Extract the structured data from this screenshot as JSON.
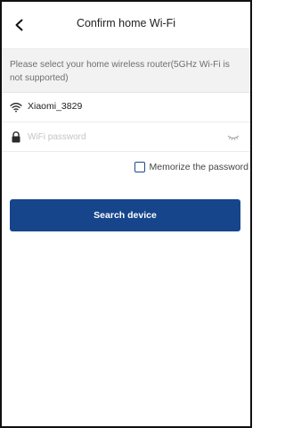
{
  "header": {
    "title": "Confirm home Wi-Fi",
    "back_icon": "chevron-left-icon"
  },
  "info": {
    "text": "Please select your home wireless router(5GHz Wi-Fi is not supported)"
  },
  "wifi": {
    "icon": "wifi-icon",
    "ssid": "Xiaomi_3829"
  },
  "password": {
    "icon": "lock-icon",
    "placeholder": "WiFi password",
    "value": "",
    "toggle_icon": "eye-closed-icon"
  },
  "memorize": {
    "label": "Memorize the password",
    "checked": false
  },
  "search_button": {
    "label": "Search device"
  },
  "colors": {
    "primary": "#16458c",
    "info_bg": "#f2f2f2",
    "text": "#222222",
    "muted": "#6f6f6f",
    "placeholder": "#c4c4c4"
  }
}
